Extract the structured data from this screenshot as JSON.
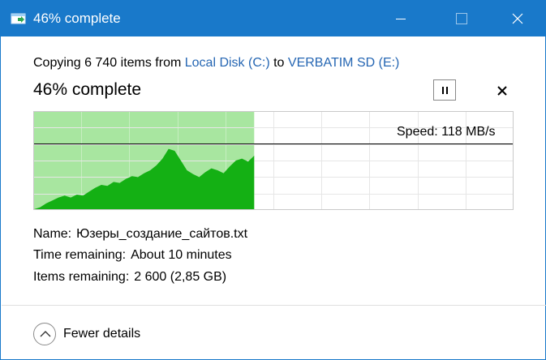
{
  "titlebar": {
    "title": "46% complete",
    "accent_color": "#1979ca"
  },
  "header": {
    "copy_prefix": "Copying 6 740 items from ",
    "source": "Local Disk (C:)",
    "copy_middle": " to ",
    "destination": "VERBATIM SD (E:)",
    "progress_text": "46% complete"
  },
  "graph": {
    "progress_fraction": 0.46,
    "speed_label": "Speed: 118 MB/s",
    "speed_fraction_of_height": 0.33,
    "fill_color": "#a8e6a0",
    "curve_color": "#14b014",
    "speed_samples": [
      0,
      0.02,
      0.06,
      0.09,
      0.12,
      0.14,
      0.12,
      0.15,
      0.14,
      0.18,
      0.22,
      0.25,
      0.24,
      0.28,
      0.27,
      0.31,
      0.34,
      0.33,
      0.37,
      0.4,
      0.45,
      0.52,
      0.62,
      0.6,
      0.5,
      0.4,
      0.36,
      0.33,
      0.38,
      0.42,
      0.4,
      0.37,
      0.44,
      0.5,
      0.52,
      0.49,
      0.55
    ]
  },
  "details": {
    "name_label": "Name:",
    "name_value": "Юзеры_создание_сайтов.txt",
    "time_label": "Time remaining:",
    "time_value": "About 10 minutes",
    "items_label": "Items remaining:",
    "items_value": "2 600 (2,85 GB)"
  },
  "footer": {
    "fewer_details_label": "Fewer details"
  },
  "icons": {
    "window_icon": "copy-arrow-icon",
    "pause": "pause-icon",
    "cancel": "close-icon",
    "collapse": "chevron-up-icon"
  }
}
